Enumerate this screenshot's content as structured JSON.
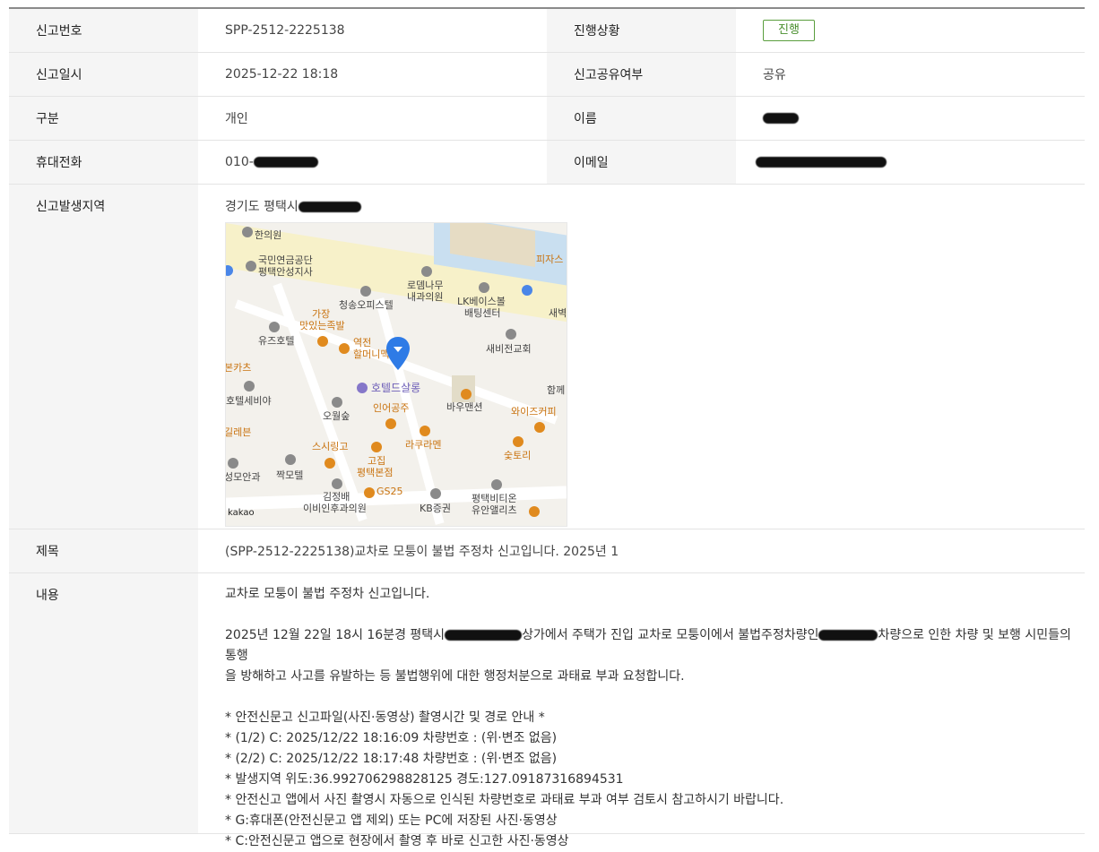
{
  "rows": {
    "report_no_label": "신고번호",
    "report_no_value": "SPP-2512-2225138",
    "status_label": "진행상황",
    "status_value": "진행",
    "date_label": "신고일시",
    "date_value": "2025-12-22 18:18",
    "share_label": "신고공유여부",
    "share_value": "공유",
    "type_label": "구분",
    "type_value": "개인",
    "name_label": "이름",
    "phone_label": "휴대전화",
    "phone_prefix": "010-",
    "email_label": "이메일",
    "location_label": "신고발생지역",
    "location_prefix": "경기도 평택시",
    "subject_label": "제목",
    "subject_value": "(SPP-2512-2225138)교차로 모퉁이 불법 주정차 신고입니다. 2025년 1",
    "content_label": "내용"
  },
  "map": {
    "pois": {
      "p1": "한의원",
      "p2": "국민연금공단",
      "p2b": "평택안성지사",
      "p3": "로뎀나무",
      "p3b": "내과의원",
      "p4": "LK베이스볼",
      "p4b": "배팅센터",
      "p5": "피자스",
      "p6": "청송오피스텔",
      "p7": "가장",
      "p7b": "맛있는족발",
      "p8": "역전",
      "p8b": "할머니맥",
      "p9": "유즈호텔",
      "p10": "새비전교회",
      "p11": "새벽",
      "p12": "본카츠",
      "p13": "호텔드살롱",
      "p14": "호텔세비야",
      "p15": "함께",
      "p16": "인어공주",
      "p17": "바우맨션",
      "p18": "오월숲",
      "p19": "와이즈커피",
      "p20": "길레븐",
      "p21": "스시링고",
      "p22": "라쿠라멘",
      "p23": "숯토리",
      "p24": "고집",
      "p24b": "평택본점",
      "p25": "짝모텔",
      "p26": "성모안과",
      "p27": "김정배",
      "p27b": "이비인후과의원",
      "p28": "GS25",
      "p29": "KB증권",
      "p30": "평택비티온",
      "p30b": "유안앨리츠",
      "logo": "kakao"
    }
  },
  "content": {
    "line1": "교차로 모퉁이 불법 주정차 신고입니다.",
    "line2a": "2025년 12월 22일 18시 16분경 평택시",
    "line2b": "상가에서 주택가 진입 교차로 모퉁이에서 불법주정차량인",
    "line2c": "차량으로 인한 차량 및 보행 시민들의 통행",
    "line3": "을 방해하고 사고를 유발하는 등 불법행위에 대한 행정처분으로 과태료 부과 요청합니다.",
    "line4": "* 안전신문고 신고파일(사진·동영상) 촬영시간 및 경로 안내 *",
    "line5": "* (1/2) C: 2025/12/22 18:16:09 차량번호 : (위·변조 없음)",
    "line6": "* (2/2) C: 2025/12/22 18:17:48 차량번호 : (위·변조 없음)",
    "line7": "* 발생지역 위도:36.992706298828125 경도:127.09187316894531",
    "line8": "* 안전신고 앱에서 사진 촬영시 자동으로 인식된 차량번호로 과태료 부과 여부 검토시 참고하시기 바랍니다.",
    "line9": "* G:휴대폰(안전신문고 앱 제외) 또는 PC에 저장된 사진·동영상",
    "line10": "* C:안전신문고 앱으로 현장에서 촬영 후 바로 신고한 사진·동영상"
  }
}
